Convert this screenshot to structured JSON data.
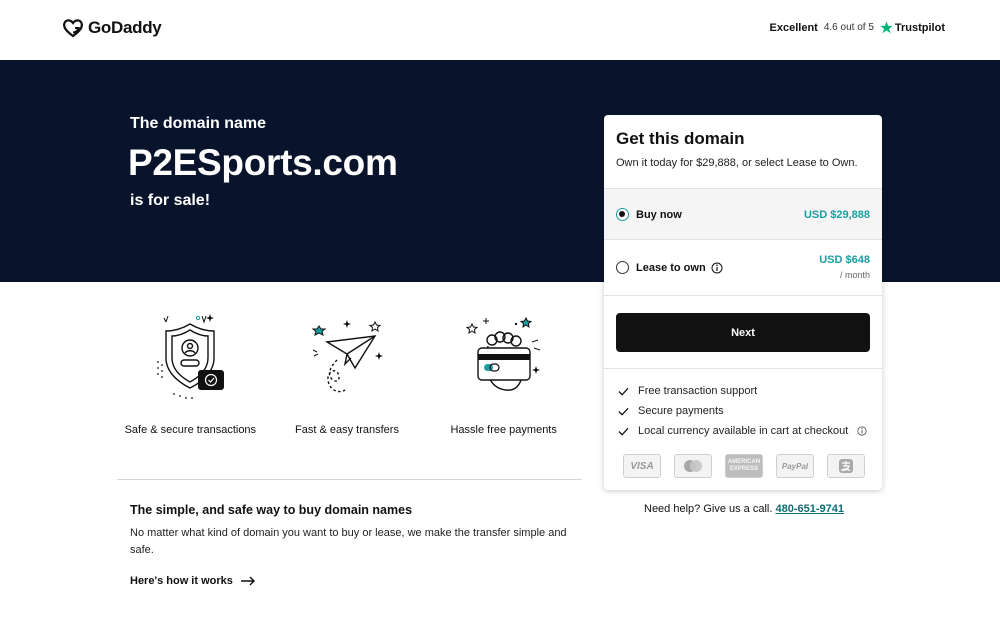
{
  "header": {
    "logo_text": "GoDaddy",
    "trust_rating_word": "Excellent",
    "trust_score": "4.6 out of 5",
    "trust_brand": "Trustpilot"
  },
  "hero": {
    "pre_text": "The domain name",
    "domain": "P2ESports.com",
    "post_text": "is for sale!"
  },
  "features": [
    {
      "icon": "shield-user-icon",
      "label": "Safe & secure transactions"
    },
    {
      "icon": "paper-plane-icon",
      "label": "Fast & easy transfers"
    },
    {
      "icon": "card-hand-icon",
      "label": "Hassle free payments"
    }
  ],
  "info": {
    "title": "The simple, and safe way to buy domain names",
    "body": "No matter what kind of domain you want to buy or lease, we make the transfer simple and safe.",
    "link": "Here's how it works"
  },
  "card": {
    "title": "Get this domain",
    "subtitle": "Own it today for $29,888, or select Lease to Own.",
    "buy": {
      "label": "Buy now",
      "price": "USD $29,888",
      "selected": true
    },
    "lease": {
      "label": "Lease to own",
      "price": "USD $648",
      "period": "/ month",
      "selected": false
    },
    "next_label": "Next",
    "perks": [
      "Free transaction support",
      "Secure payments",
      "Local currency available in cart at checkout"
    ],
    "payments": [
      "VISA",
      "mastercard",
      "AMERICAN EXPRESS",
      "PayPal",
      "alipay"
    ]
  },
  "help": {
    "text": "Need help? Give us a call.",
    "phone": "480-651-9741"
  },
  "colors": {
    "hero_bg": "#09142c",
    "accent": "#1a9ea3",
    "button": "#111111"
  }
}
